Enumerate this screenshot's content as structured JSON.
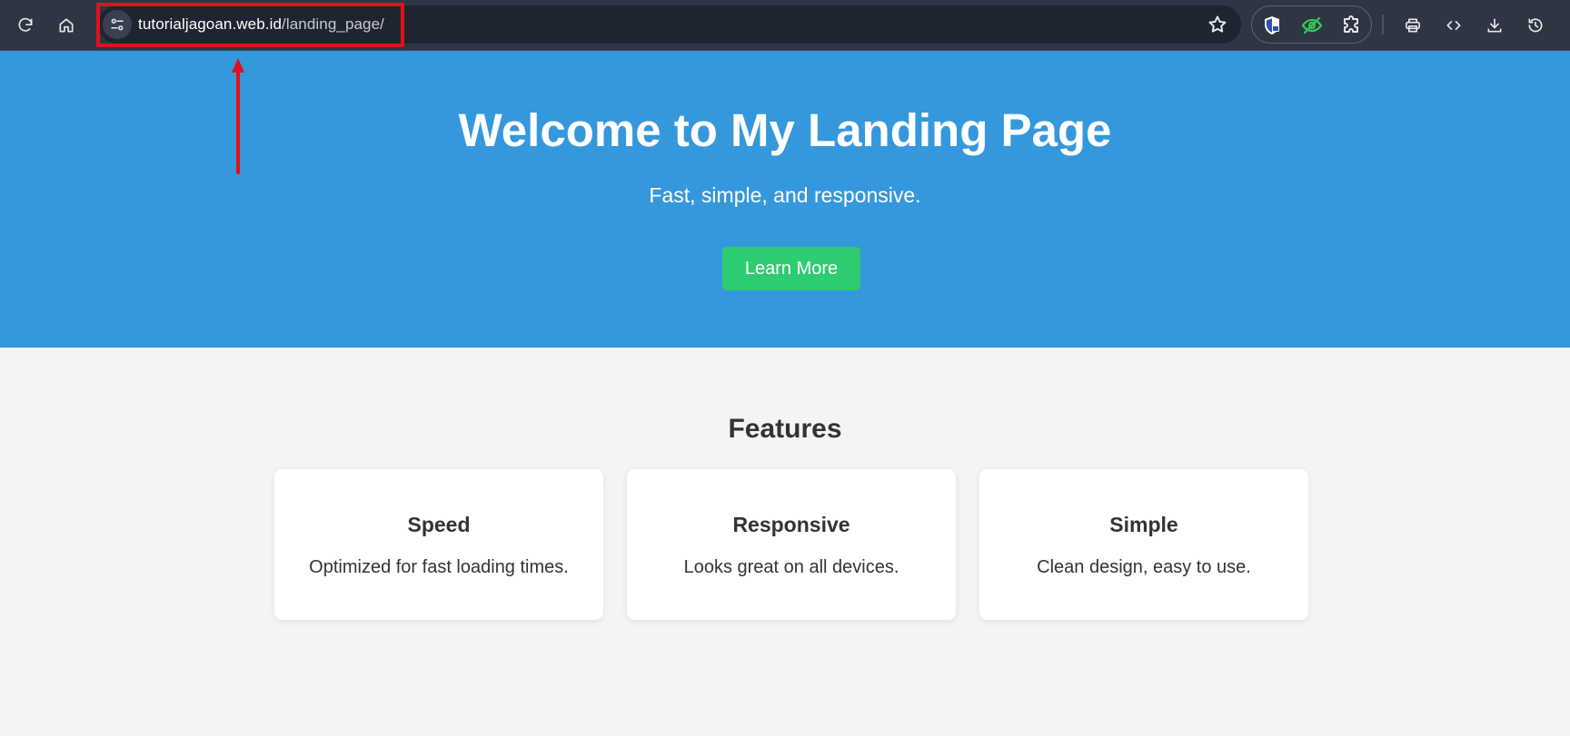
{
  "browser": {
    "url_host": "tutorialjagoan.web.id",
    "url_path": "/landing_page/",
    "icons": {
      "reload": "reload-icon",
      "home": "home-icon",
      "site_info": "tune-icon",
      "bookmark": "star-icon",
      "ext_shield": "shield-lock-icon",
      "ext_eye": "eye-slash-icon",
      "extensions": "puzzle-icon",
      "print": "print-icon",
      "source": "code-icon",
      "download": "download-icon",
      "history": "history-icon"
    },
    "colors": {
      "toolbar": "#2f3542",
      "omnibox": "#1f2431",
      "annotation": "#e0111b",
      "eye_ext": "#34c759"
    }
  },
  "hero": {
    "title": "Welcome to My Landing Page",
    "subtitle": "Fast, simple, and responsive.",
    "button_label": "Learn More",
    "background": "#3598dc",
    "button_color": "#2ecc71"
  },
  "features": {
    "title": "Features",
    "cards": [
      {
        "title": "Speed",
        "text": "Optimized for fast loading times."
      },
      {
        "title": "Responsive",
        "text": "Looks great on all devices."
      },
      {
        "title": "Simple",
        "text": "Clean design, easy to use."
      }
    ]
  }
}
